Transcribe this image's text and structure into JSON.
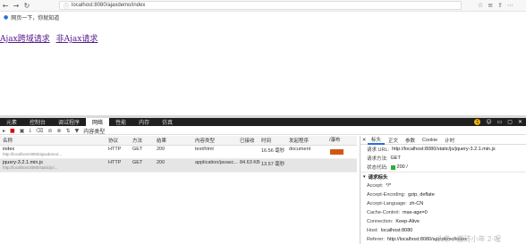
{
  "browser": {
    "url": "localhost:8080/ajaxdemo/index",
    "bookmark": "网页一下，你就知道"
  },
  "page": {
    "links": [
      "Ajax跨域请求",
      "非Ajax请求"
    ]
  },
  "devtools": {
    "tabs": [
      "元素",
      "控制台",
      "调试程序",
      "网络",
      "性能",
      "内存",
      "仿真"
    ],
    "active_tab": "网络",
    "warning_count": "1",
    "content_type_label": "内容类型",
    "columns": [
      "名称",
      "协议",
      "方法",
      "结果",
      "内容类型",
      "已接收",
      "时间",
      "发起程序",
      " "
    ],
    "rows": [
      {
        "name": "index",
        "path": "http://localhost:8080/ajaxdemo/...",
        "protocol": "HTTP",
        "method": "GET",
        "result": "200",
        "type": "text/html",
        "received": "",
        "time": "16.56 毫秒",
        "initiator": "document"
      },
      {
        "name": "jquery-3.2.1.min.js",
        "path": "http://localhost:8080/static/js/...",
        "protocol": "HTTP",
        "method": "GET",
        "result": "200",
        "type": "application/javasc...",
        "received": "84.63 KB",
        "time": "13.57 毫秒",
        "initiator": ""
      }
    ],
    "waterfall_label": "/瀑布"
  },
  "details": {
    "tabs": [
      "标头",
      "正文",
      "参数",
      "Cookie",
      "计时"
    ],
    "request_url_label": "请求 URL:",
    "request_url": "http://localhost:8080/static/js/jquery-3.2.1.min.js",
    "request_method_label": "请求方法:",
    "request_method": "GET",
    "status_code_label": "状态代码:",
    "status_code": "200 /",
    "request_headers_title": "请求标头",
    "headers": [
      {
        "k": "Accept:",
        "v": "*/*"
      },
      {
        "k": "Accept-Encoding:",
        "v": "gzip, deflate"
      },
      {
        "k": "Accept-Language:",
        "v": "zh-CN"
      },
      {
        "k": "Cache-Control:",
        "v": "max-age=0"
      },
      {
        "k": "Connection:",
        "v": "Keep-Alive"
      },
      {
        "k": "Host:",
        "v": "localhost:8080"
      },
      {
        "k": "Referer:",
        "v": "http://localhost:8080/ajaxdemo/index"
      }
    ]
  },
  "watermark": "头条 / 搬砖小年 2·喔"
}
